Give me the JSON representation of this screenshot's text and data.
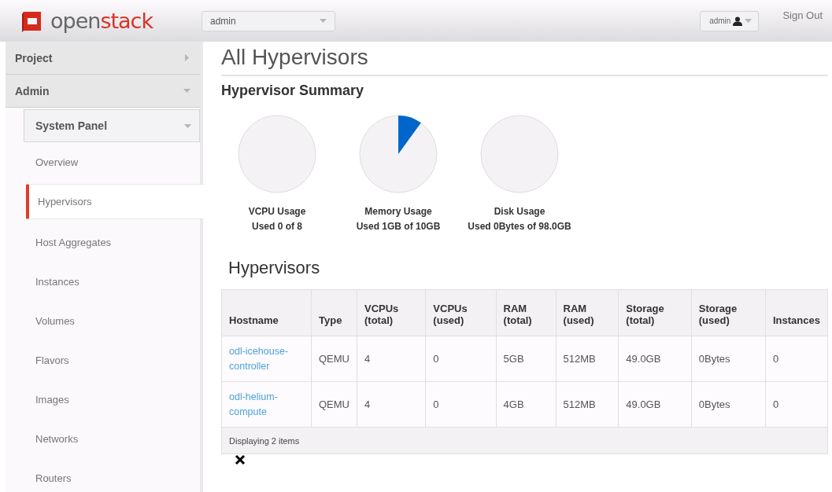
{
  "header": {
    "logo": {
      "parts": [
        "open",
        "stack"
      ]
    },
    "project_select": {
      "value": "admin"
    },
    "user_menu": {
      "label": "admin"
    },
    "sign_out": "Sign Out"
  },
  "sidebar": {
    "items": [
      {
        "label": "Project",
        "expanded": false
      },
      {
        "label": "Admin",
        "expanded": true,
        "children": [
          {
            "label": "System Panel",
            "expanded": true,
            "children": [
              {
                "label": "Overview",
                "selected": false
              },
              {
                "label": "Hypervisors",
                "selected": true
              },
              {
                "label": "Host Aggregates",
                "selected": false
              },
              {
                "label": "Instances",
                "selected": false
              },
              {
                "label": "Volumes",
                "selected": false
              },
              {
                "label": "Flavors",
                "selected": false
              },
              {
                "label": "Images",
                "selected": false
              },
              {
                "label": "Networks",
                "selected": false
              },
              {
                "label": "Routers",
                "selected": false
              }
            ]
          }
        ]
      }
    ]
  },
  "page_title": "All Hypervisors",
  "summary": {
    "title": "Hypervisor Summary",
    "usages": [
      {
        "label": "VCPU Usage",
        "detail": "Used 0 of 8"
      },
      {
        "label": "Memory Usage",
        "detail": "Used 1GB of 10GB"
      },
      {
        "label": "Disk Usage",
        "detail": "Used 0Bytes of 98.0GB"
      }
    ]
  },
  "table": {
    "title": "Hypervisors",
    "columns": [
      "Hostname",
      "Type",
      "VCPUs (total)",
      "VCPUs (used)",
      "RAM (total)",
      "RAM (used)",
      "Storage (total)",
      "Storage (used)",
      "Instances"
    ],
    "rows": [
      [
        "odl-icehouse-controller",
        "QEMU",
        "4",
        "0",
        "5GB",
        "512MB",
        "49.0GB",
        "0Bytes",
        "0"
      ],
      [
        "odl-helium-compute",
        "QEMU",
        "4",
        "0",
        "4GB",
        "512MB",
        "49.0GB",
        "0Bytes",
        "0"
      ]
    ],
    "footer": "Displaying 2 items"
  }
}
